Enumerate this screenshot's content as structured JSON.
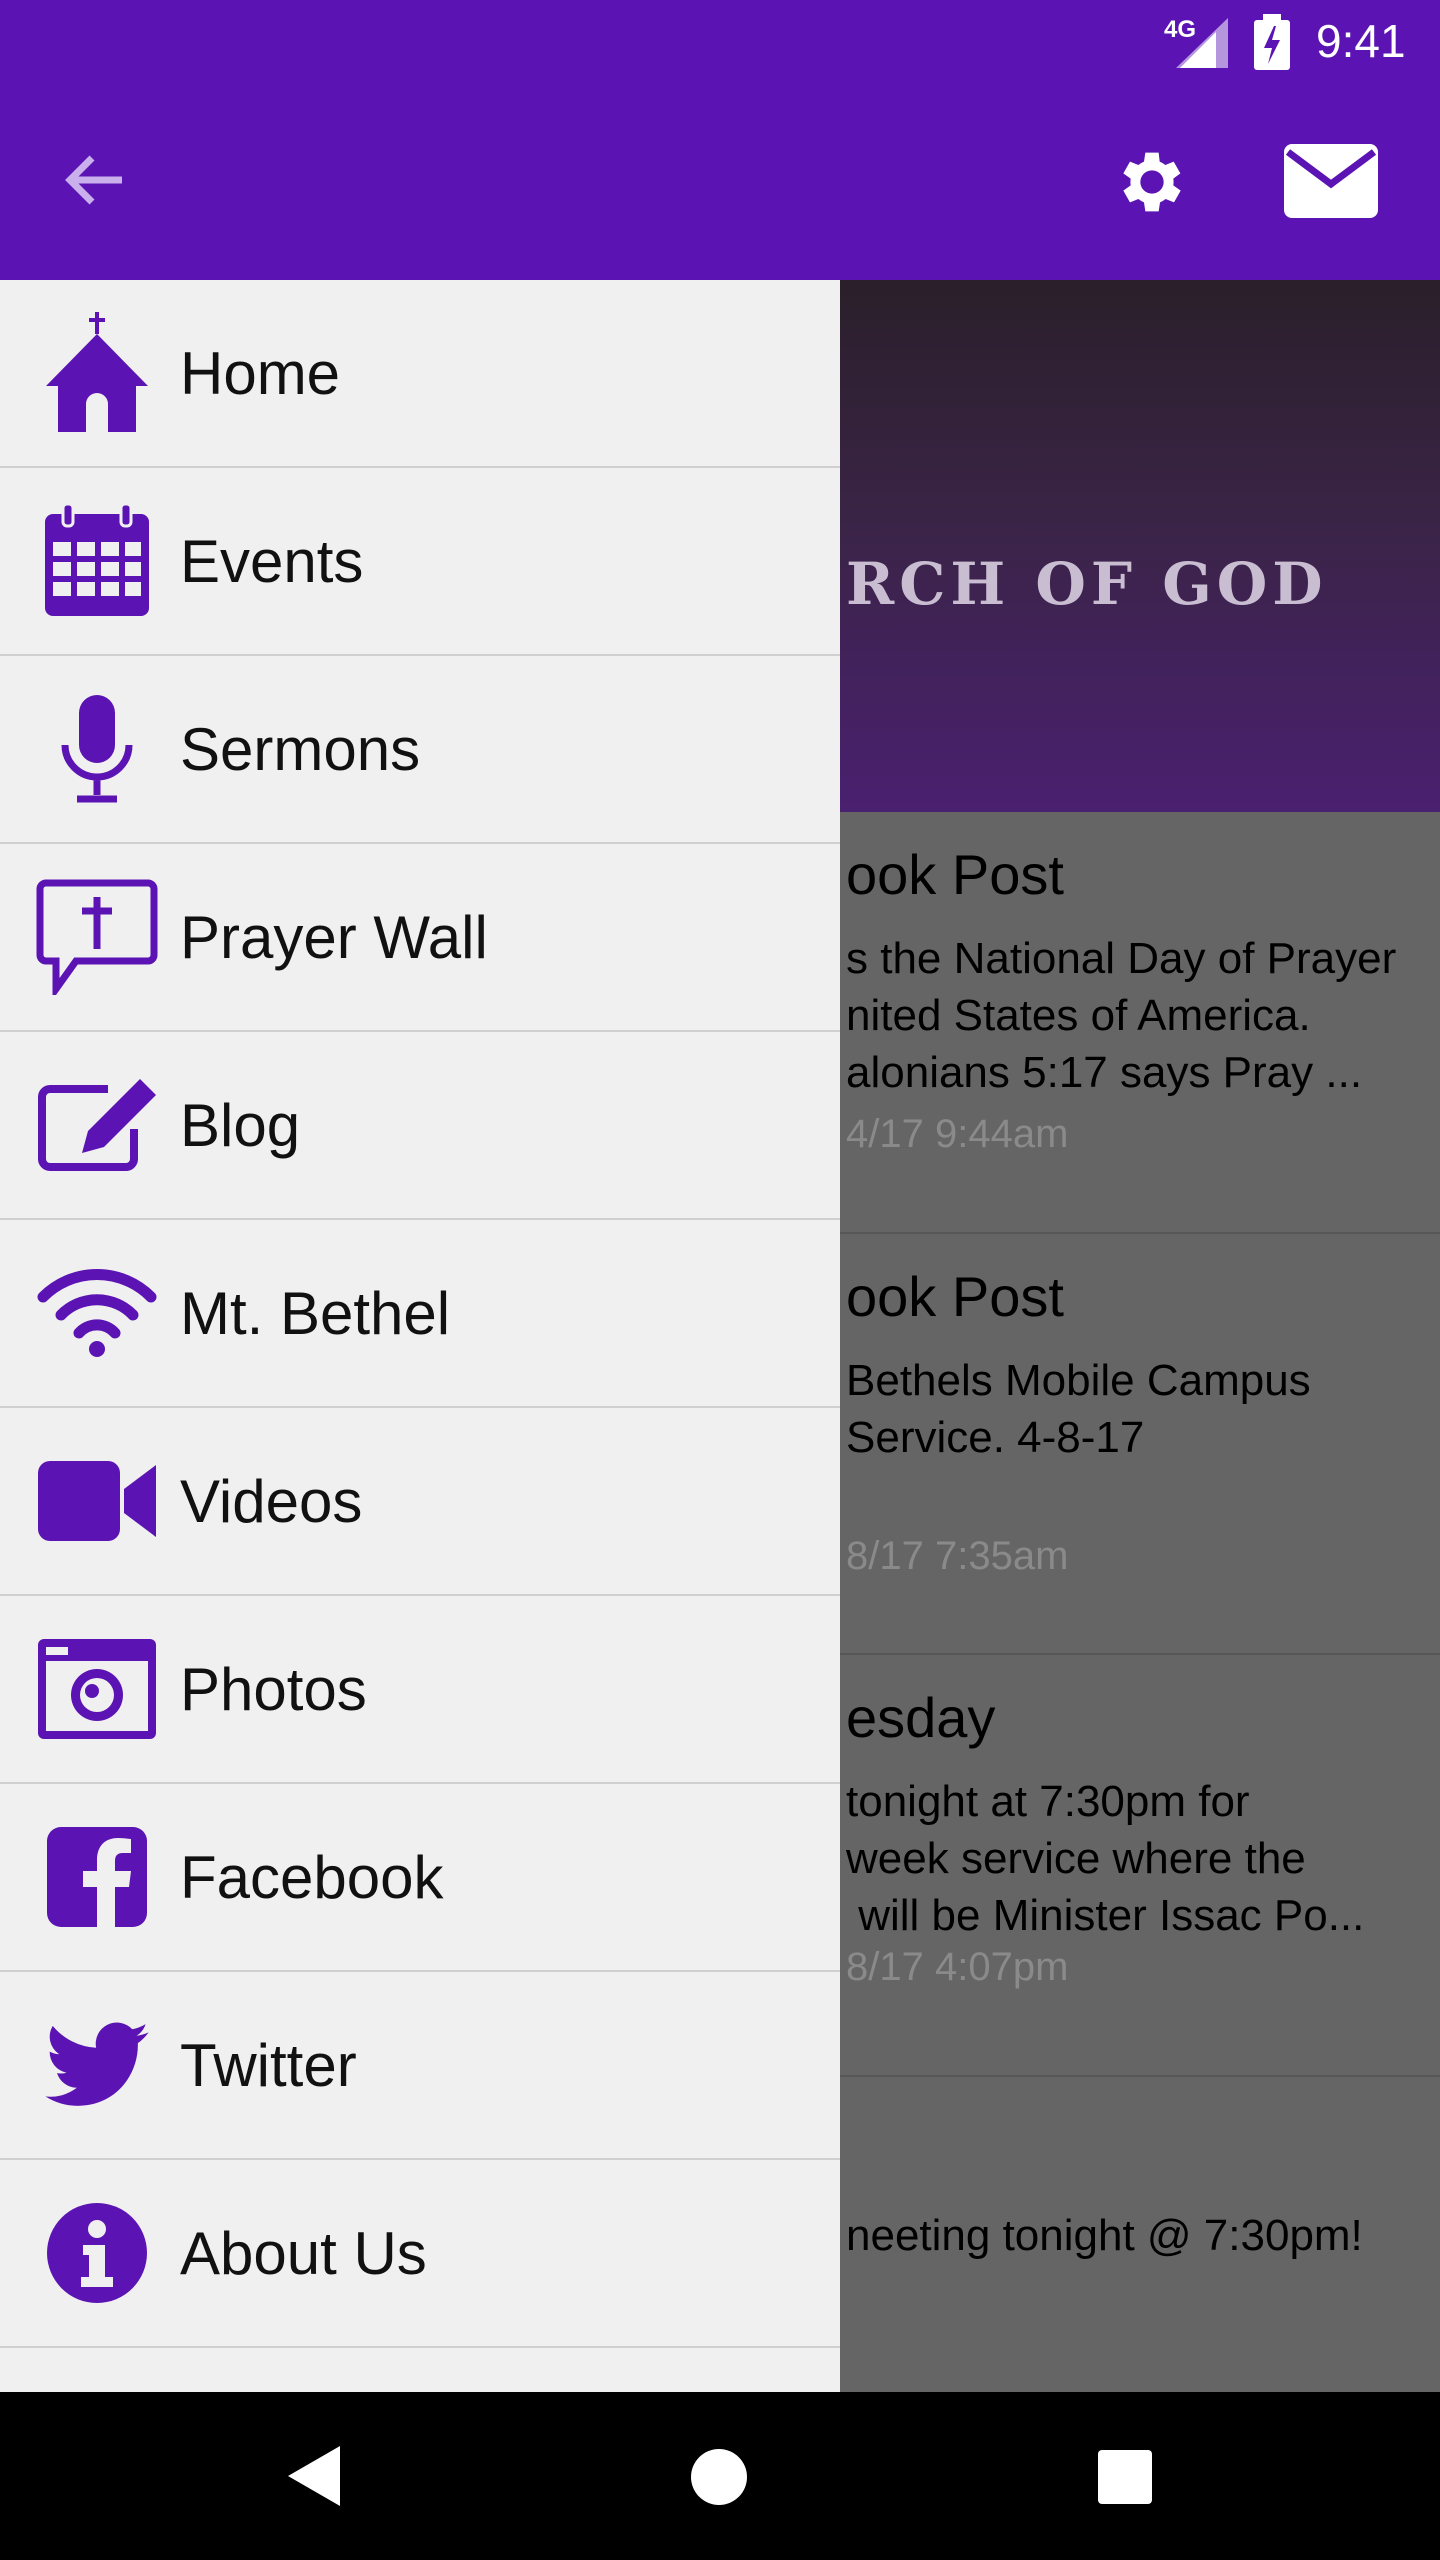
{
  "status_bar": {
    "network": "4G",
    "time": "9:41"
  },
  "app_bar": {
    "back_icon": "arrow-left-icon",
    "settings_icon": "gear-icon",
    "mail_icon": "envelope-icon"
  },
  "colors": {
    "brand": "#5b14b3",
    "icon": "#5b14b3"
  },
  "banner": {
    "text": "RCH OF GOD"
  },
  "posts": [
    {
      "title": "ook Post",
      "body": "s the National Day of Prayer\nnited States of America.\nalonians 5:17 says Pray ...",
      "date": "4/17 9:44am"
    },
    {
      "title": "ook Post",
      "body": "Bethels Mobile Campus\nService. 4-8-17",
      "date": "8/17 7:35am"
    },
    {
      "title": "esday",
      "body": "tonight at 7:30pm for\nweek service where the\n will be Minister Issac Po...",
      "date": "8/17 4:07pm"
    },
    {
      "title": "",
      "body": "neeting tonight @ 7:30pm!",
      "date": ""
    }
  ],
  "drawer": {
    "items": [
      {
        "label": "Home",
        "icon": "church-home-icon"
      },
      {
        "label": "Events",
        "icon": "calendar-icon"
      },
      {
        "label": "Sermons",
        "icon": "microphone-icon"
      },
      {
        "label": "Prayer Wall",
        "icon": "speech-cross-icon"
      },
      {
        "label": "Blog",
        "icon": "edit-icon"
      },
      {
        "label": "Mt. Bethel",
        "icon": "wifi-icon"
      },
      {
        "label": "Videos",
        "icon": "video-camera-icon"
      },
      {
        "label": "Photos",
        "icon": "camera-icon"
      },
      {
        "label": "Facebook",
        "icon": "facebook-icon"
      },
      {
        "label": "Twitter",
        "icon": "twitter-icon"
      },
      {
        "label": "About Us",
        "icon": "info-icon"
      }
    ]
  },
  "nav_bar": {
    "back": "back-triangle-icon",
    "home": "home-circle-icon",
    "recents": "recents-square-icon"
  }
}
